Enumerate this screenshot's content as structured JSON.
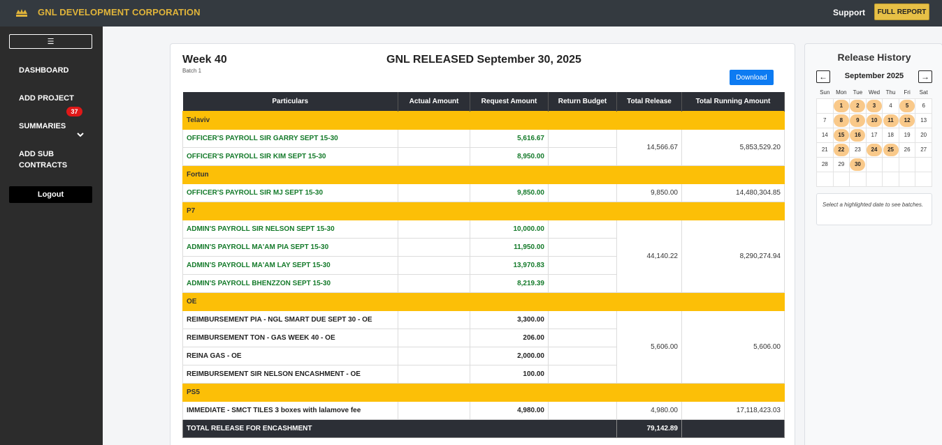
{
  "header": {
    "title": "GNL DEVELOPMENT CORPORATION",
    "support": "Support",
    "full_report": "FULL REPORT",
    "accent_color": "#e0b43a"
  },
  "sidebar": {
    "menu_icon": "☰",
    "items": [
      {
        "label": "DASHBOARD"
      },
      {
        "label": "ADD PROJECT"
      },
      {
        "label": "SUMMARIES",
        "badge": "37"
      },
      {
        "label": "ADD SUB CONTRACTS"
      }
    ],
    "logout": "Logout"
  },
  "report": {
    "week": "Week 40",
    "batch": "Batch 1",
    "title": "GNL RELEASED September 30, 2025",
    "download": "Download",
    "columns": [
      "Particulars",
      "Actual Amount",
      "Request Amount",
      "Return Budget",
      "Total Release",
      "Total Running Amount"
    ],
    "groups": [
      {
        "name": "Telaviv",
        "total_release": "14,566.67",
        "running": "5,853,529.20",
        "rows": [
          {
            "particular": "OFFICER'S PAYROLL SIR GARRY SEPT 15-30",
            "request": "5,616.67"
          },
          {
            "particular": "OFFICER'S PAYROLL SIR KIM SEPT 15-30",
            "request": "8,950.00"
          }
        ]
      },
      {
        "name": "Fortun",
        "total_release": "9,850.00",
        "running": "14,480,304.85",
        "rows": [
          {
            "particular": "OFFICER'S PAYROLL SIR MJ SEPT 15-30",
            "request": "9,850.00"
          }
        ]
      },
      {
        "name": "P7",
        "total_release": "44,140.22",
        "running": "8,290,274.94",
        "rows": [
          {
            "particular": "ADMIN'S PAYROLL SIR NELSON SEPT 15-30",
            "request": "10,000.00"
          },
          {
            "particular": "ADMIN'S PAYROLL MA'AM PIA SEPT 15-30",
            "request": "11,950.00"
          },
          {
            "particular": "ADMIN'S PAYROLL MA'AM LAY SEPT 15-30",
            "request": "13,970.83"
          },
          {
            "particular": "ADMIN'S PAYROLL BHENZZON SEPT 15-30",
            "request": "8,219.39"
          }
        ]
      },
      {
        "name": "OE",
        "total_release": "5,606.00",
        "running": "5,606.00",
        "rows": [
          {
            "particular": "REIMBURSEMENT PIA - NGL SMART DUE SEPT 30 - OE",
            "request": "3,300.00"
          },
          {
            "particular": "REIMBURSEMENT TON - GAS WEEK 40 - OE",
            "request": "206.00"
          },
          {
            "particular": "REINA GAS - OE",
            "request": "2,000.00"
          },
          {
            "particular": "REIMBURSEMENT SIR NELSON ENCASHMENT - OE",
            "request": "100.00"
          }
        ]
      },
      {
        "name": "PS5",
        "total_release": "4,980.00",
        "running": "17,118,423.03",
        "rows": [
          {
            "particular": "IMMEDIATE - SMCT TILES 3 boxes with lalamove fee",
            "request": "4,980.00"
          }
        ]
      }
    ],
    "total_label": "TOTAL RELEASE FOR ENCASHMENT",
    "total_value": "79,142.89"
  },
  "history": {
    "title": "Release History",
    "prev": "←",
    "next": "→",
    "month": "September 2025",
    "weekdays": [
      "Sun",
      "Mon",
      "Tue",
      "Wed",
      "Thu",
      "Fri",
      "Sat"
    ],
    "highlighted": [
      1,
      2,
      3,
      5,
      8,
      9,
      10,
      11,
      12,
      15,
      16,
      22,
      24,
      25,
      30
    ],
    "hint": "Select a highlighted date to see batches."
  }
}
